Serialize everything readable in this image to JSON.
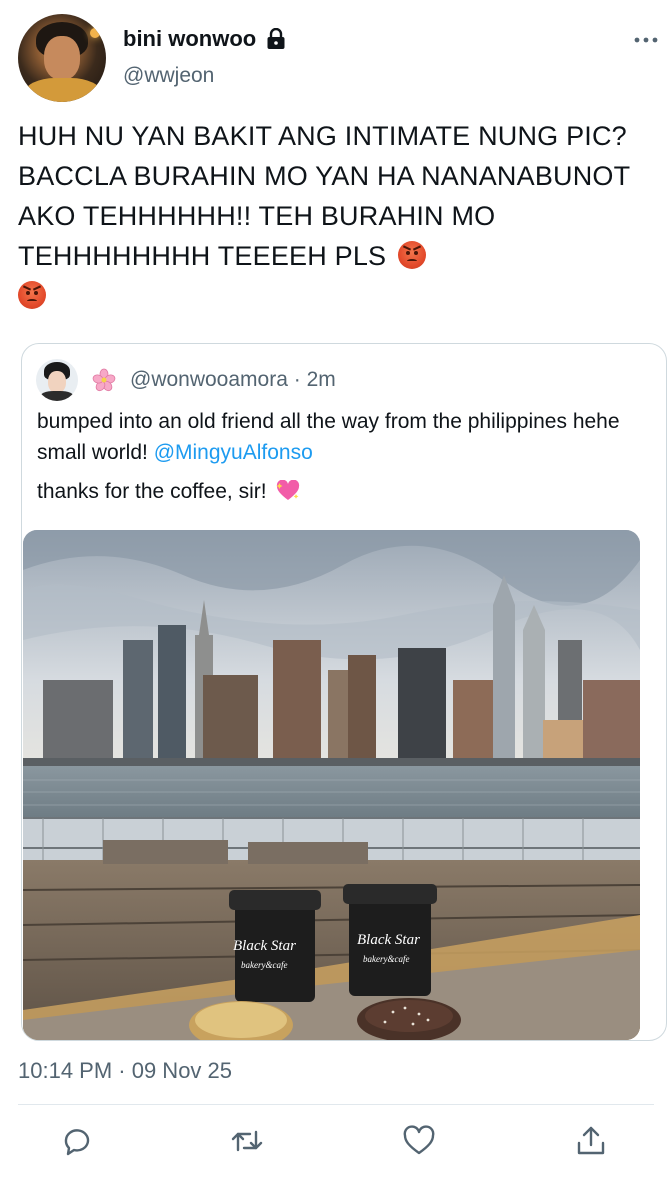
{
  "author": {
    "display_name": "bini wonwoo",
    "handle": "@wwjeon",
    "protected": true
  },
  "tweet": {
    "text": "HUH NU YAN BAKIT ANG INTIMATE NUNG PIC? BACCLA BURAHIN MO YAN HA NANANABUNOT AKO TEHHHHHH!! TEH BURAHIN MO TEHHHHHHHH TEEEEH PLS",
    "trailing_emojis": [
      "angry-face",
      "angry-face"
    ],
    "timestamp": "10:14 PM · 09 Nov 25"
  },
  "quoted_tweet": {
    "handle": "@wonwooamora",
    "age": "2m",
    "line1": "bumped into an old friend all the way from the philippines hehe small world!",
    "mention": "@MingyuAlfonso",
    "line2": "thanks for the coffee, sir!",
    "name_emoji": "cherry-blossom",
    "line2_emoji": "sparkling-heart",
    "photo_description_icon": "city-skyline-coffee-photo",
    "cup_text": "Black Star",
    "cup_subtext": "bakery&cafe"
  },
  "actions": [
    {
      "icon": "reply-icon"
    },
    {
      "icon": "retweet-icon"
    },
    {
      "icon": "like-icon"
    },
    {
      "icon": "share-icon"
    }
  ],
  "colors": {
    "text": "#0f1419",
    "secondary": "#536471",
    "link": "#1d9bf0",
    "border": "#cfd9de"
  }
}
